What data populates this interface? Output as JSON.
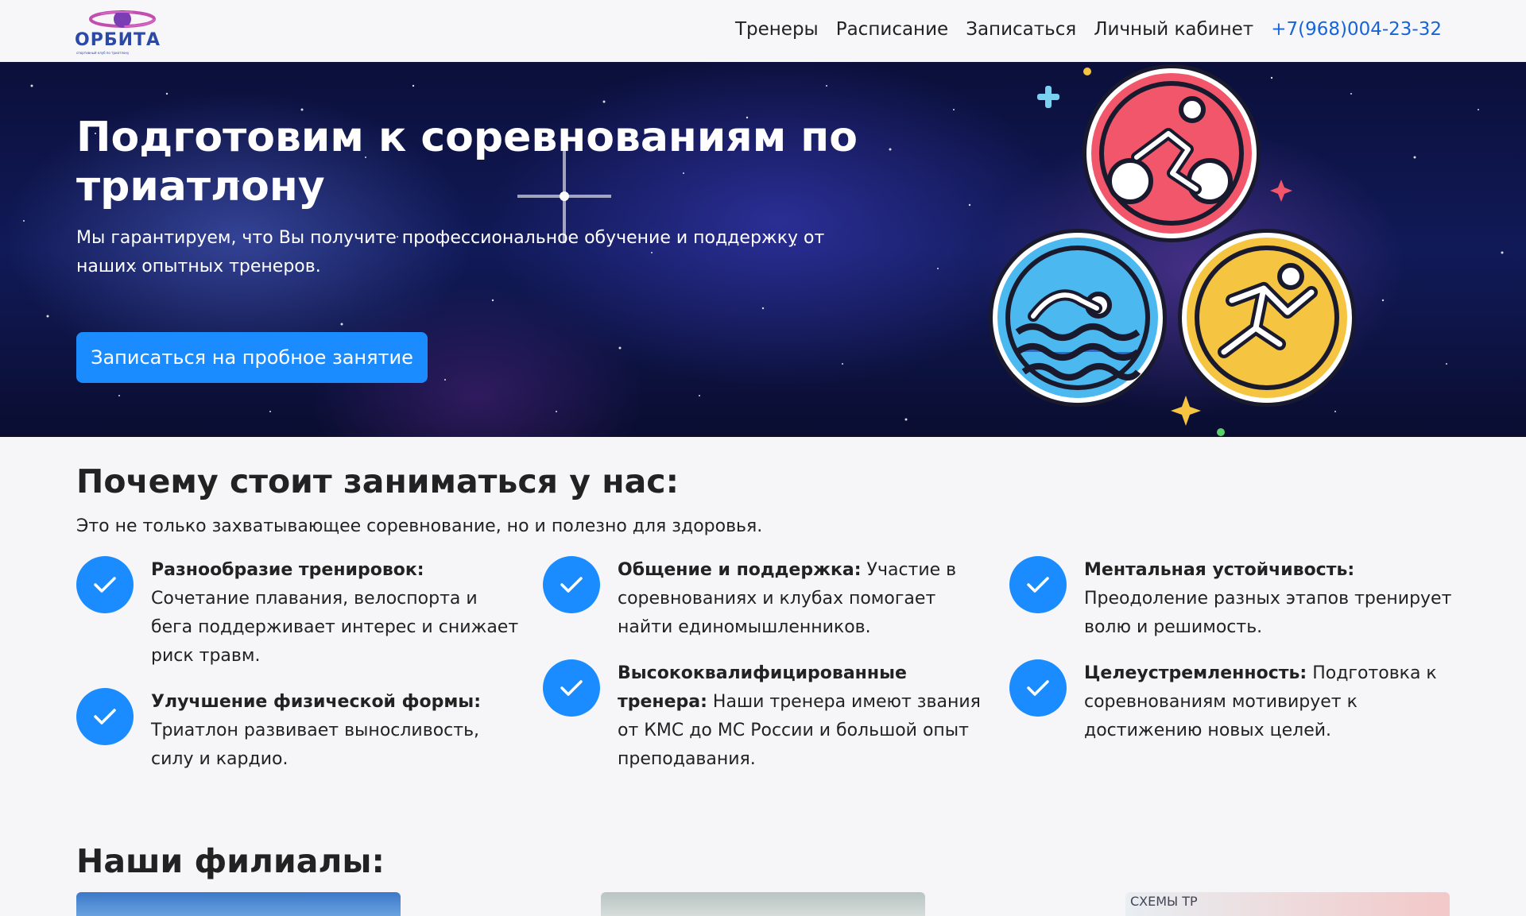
{
  "header": {
    "logo_text": "ОРБИТА",
    "logo_subtext": "спортивный клуб по триатлону",
    "nav": [
      "Тренеры",
      "Расписание",
      "Записаться",
      "Личный кабинет"
    ],
    "phone": "+7(968)004-23-32"
  },
  "hero": {
    "title": "Подготовим к соревнованиям по триатлону",
    "subtitle": "Мы гарантируем, что Вы получите профессиональное обучение и поддержку от наших опытных тренеров.",
    "button": "Записаться на пробное занятие"
  },
  "why": {
    "title": "Почему стоит заниматься у нас:",
    "subtitle": "Это не только захватывающее соревнование, но и полезно для здоровья.",
    "features": [
      {
        "bold": "Разнообразие тренировок:",
        "text": " Сочетание плавания, велоспорта и бега поддерживает интерес и снижает риск травм."
      },
      {
        "bold": "Улучшение физической формы:",
        "text": " Триатлон развивает выносливость, силу и кардио."
      },
      {
        "bold": "Общение и поддержка:",
        "text": " Участие в соревнованиях и клубах помогает найти единомышленников."
      },
      {
        "bold": "Высококвалифицированные тренера:",
        "text": " Наши тренера имеют звания от КМС до МС России и большой опыт преподавания."
      },
      {
        "bold": "Ментальная устойчивость:",
        "text": " Преодоление разных этапов тренирует волю и решимость."
      },
      {
        "bold": "Целеустремленность:",
        "text": " Подготовка к соревнованиям мотивирует к достижению новых целей."
      }
    ]
  },
  "branches": {
    "title": "Наши филиалы:",
    "card3_text": "СХЕМЫ ТР"
  },
  "colors": {
    "accent": "#1a8cff",
    "phone": "#1565d8",
    "bike_badge": "#f2566a",
    "swim_badge": "#4cb8f0",
    "run_badge": "#f5c542"
  }
}
